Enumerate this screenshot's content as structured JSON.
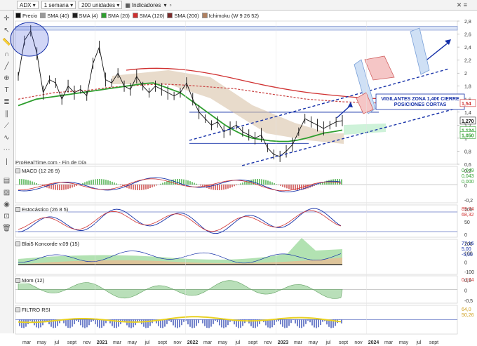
{
  "toolbar": {
    "symbol": "ADX",
    "timeframe": "1 semana",
    "units": "200 unidades",
    "indicators": "Indicadores"
  },
  "legend": [
    {
      "label": "Precio",
      "color": "#111111"
    },
    {
      "label": "SMA (40)",
      "color": "#999999"
    },
    {
      "label": "SMA (4)",
      "color": "#222222"
    },
    {
      "label": "SMA (20)",
      "color": "#2e9e2e"
    },
    {
      "label": "SMA (120)",
      "color": "#d03030"
    },
    {
      "label": "SMA (200)",
      "color": "#7a2a2a"
    },
    {
      "label": "Ichimoku (W 9 26 52)",
      "color": "#b08060"
    }
  ],
  "source": "ProRealTime.com - Fin de Día",
  "annotation": "VIGILANTES ZONA 1,40€ CIERRE POSICIONES CORTAS",
  "panels": {
    "macd": "MACD (12 26 9)",
    "stoch": "Estocástico (26 8 5)",
    "koncorde": "Blai5 Koncorde v.09 (15)",
    "mom": "Mom (12)",
    "rsi": "FILTRO RSI"
  },
  "x_axis": [
    "mar",
    "may",
    "jul",
    "sept",
    "nov",
    "2021",
    "mar",
    "may",
    "jul",
    "sept",
    "nov",
    "2022",
    "mar",
    "may",
    "jul",
    "sept",
    "nov",
    "2023",
    "mar",
    "may",
    "jul",
    "sept",
    "nov",
    "2024",
    "mar",
    "may",
    "jul",
    "sept"
  ],
  "price_axis": [
    "2,8",
    "2,6",
    "2,4",
    "2,2",
    "2",
    "1,8",
    "1,6",
    "1,4",
    "1,2",
    "1",
    "0,8",
    "0,6"
  ],
  "price_labels": [
    {
      "text": "1,54",
      "color": "#d03030"
    },
    {
      "text": "1,270",
      "color": "#111111"
    },
    {
      "text": "1,124",
      "color": "#2e9e2e"
    },
    {
      "text": "1,050",
      "color": "#2e9e2e"
    }
  ],
  "macd_axis": [
    "0,2",
    "0",
    "-0,2"
  ],
  "macd_labels": [
    "0,049",
    "0,043",
    "0,000"
  ],
  "stoch_axis": [
    "100",
    "50",
    "0"
  ],
  "stoch_labels": [
    "89,74",
    "68,32"
  ],
  "kon_axis": [
    "200",
    "100",
    "0",
    "-100"
  ],
  "kon_labels": [
    "77,16",
    "5,00",
    "-5,00"
  ],
  "mom_axis": [
    "0,5",
    "0",
    "-0,5"
  ],
  "mom_labels": [
    "0,174"
  ],
  "rsi_labels": [
    "64,0",
    "50,26"
  ],
  "chart_data": {
    "type": "line",
    "series": [
      {
        "name": "Precio",
        "values": [
          1.95,
          2.5,
          2.65,
          2.3,
          1.7,
          1.9,
          1.85,
          1.6,
          1.8,
          1.7,
          1.75,
          1.65,
          2.15,
          2.4,
          1.9,
          1.85,
          2.0,
          1.8,
          1.75,
          1.95,
          1.8,
          1.7,
          1.8,
          1.75,
          1.7,
          1.65,
          1.7,
          1.85,
          1.6,
          1.4,
          1.3,
          1.2,
          1.25,
          1.1,
          1.15,
          1.2,
          1.1,
          1.05,
          1.0,
          1.05,
          0.85,
          0.75,
          0.72,
          0.8,
          0.9,
          1.1,
          1.3,
          1.25,
          1.2,
          1.15,
          1.2,
          1.25,
          1.27
        ]
      },
      {
        "name": "SMA (20)",
        "values": [
          1.5,
          1.55,
          1.6,
          1.62,
          1.64,
          1.66,
          1.68,
          1.7,
          1.72,
          1.74,
          1.76,
          1.78,
          1.8,
          1.82,
          1.84,
          1.85,
          1.8,
          1.75,
          1.7,
          1.6,
          1.5,
          1.4,
          1.3,
          1.2,
          1.12,
          1.05,
          1.0,
          0.98,
          0.96,
          0.95,
          0.95,
          0.97,
          1.0,
          1.04,
          1.08,
          1.1,
          1.124
        ]
      },
      {
        "name": "SMA (120)",
        "values": [
          1.6,
          1.65,
          1.7,
          1.72,
          1.74,
          1.78,
          1.8,
          1.82,
          1.83,
          1.82,
          1.8,
          1.78,
          1.76,
          1.72,
          1.68,
          1.64,
          1.6,
          1.58,
          1.56,
          1.55,
          1.54
        ]
      }
    ],
    "ylim": [
      0.6,
      2.8
    ],
    "ylabel": "",
    "xlabel": ""
  }
}
